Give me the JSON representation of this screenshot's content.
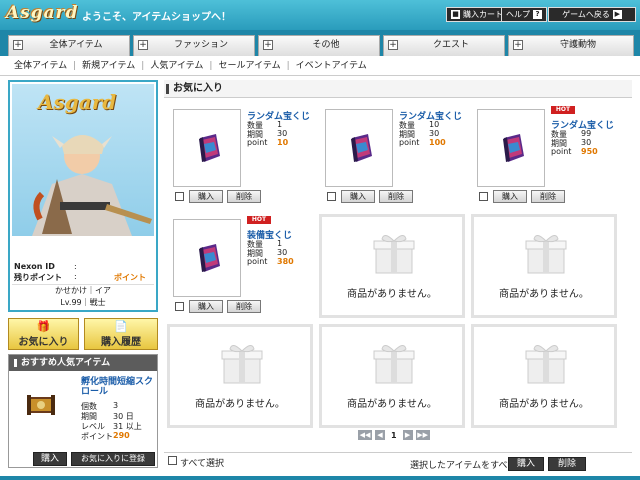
{
  "header": {
    "logo": "Asgard",
    "welcome": "ようこそ、アイテムショップへ！",
    "cart_label": "購入カート",
    "help_label": "ヘルプ",
    "back_label": "ゲームへ戻る"
  },
  "tabs": [
    "全体アイテム",
    "ファッション",
    "その他",
    "クエスト",
    "守護動物"
  ],
  "subnav": [
    "全体アイテム",
    "新規アイテム",
    "人気アイテム",
    "セールアイテム",
    "イベントアイテム"
  ],
  "profile": {
    "game_title": "Asgard",
    "nexon_id_label": "Nexon ID",
    "points_label": "残りポイント",
    "points_value": "ポイント",
    "char_name": "かせかけ｜イア",
    "char_level": "Lv.99｜戦士"
  },
  "left_buttons": {
    "favorites": "お気に入り",
    "history": "購入履歴"
  },
  "recommend": {
    "heading": "おすすめ人気アイテム",
    "title": "孵化時間短縮スクロール",
    "labels": [
      "個数",
      "期間",
      "レベル",
      "ポイント"
    ],
    "values": [
      "3",
      "30 日",
      "31 以上",
      "290"
    ],
    "buy_label": "購入",
    "fav_label": "お気に入りに登録"
  },
  "main": {
    "heading": "お気に入り",
    "row_labels": {
      "qty": "数量",
      "period": "期間",
      "point": "point"
    },
    "buy_label": "購入",
    "delete_label": "削除",
    "hot_label": "HOT",
    "empty_message": "商品がありません。",
    "items": [
      {
        "name": "ランダム宝くじ",
        "qty": "1",
        "period": "30",
        "point": "10",
        "hot": false
      },
      {
        "name": "ランダム宝くじ",
        "qty": "10",
        "period": "30",
        "point": "100",
        "hot": false
      },
      {
        "name": "ランダム宝くじ",
        "qty": "99",
        "period": "30",
        "point": "950",
        "hot": true
      },
      {
        "name": "装備宝くじ",
        "qty": "1",
        "period": "30",
        "point": "380",
        "hot": true
      }
    ],
    "page": "1"
  },
  "bottom": {
    "select_all": "すべて選択",
    "selected_all": "選択したアイテムをすべて",
    "buy_label": "購入",
    "delete_label": "削除"
  },
  "colors": {
    "accent": "#2a9cbc",
    "tab_bar": "#1e86a8",
    "point": "#e07800",
    "link": "#1a5ca8"
  }
}
